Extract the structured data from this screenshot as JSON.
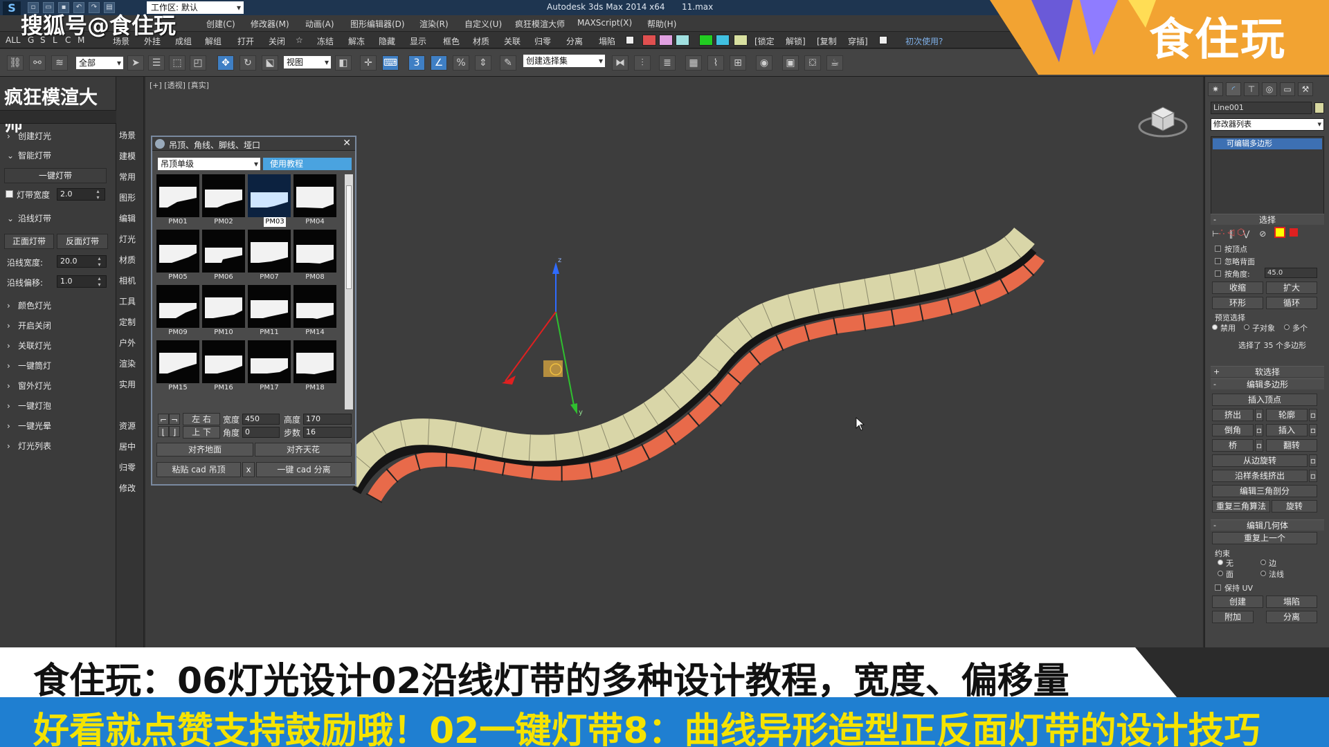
{
  "title_bar": {
    "workspace": "工作区: 默认",
    "app_title": "Autodesk 3ds Max  2014 x64",
    "file_title": "11.max"
  },
  "menu": [
    "创建(C)",
    "修改器(M)",
    "动画(A)",
    "图形编辑器(D)",
    "渲染(R)",
    "自定义(U)",
    "疯狂模渲大师",
    "MAXScript(X)",
    "帮助(H)"
  ],
  "text_toolbar": {
    "left_items": [
      "ALL",
      "G",
      "S",
      "L",
      "C",
      "M",
      "场景",
      "外挂",
      "成组",
      "解组",
      "打开",
      "关闭",
      "☆",
      "冻结",
      "解冻",
      "隐藏",
      "显示",
      "框色",
      "材质",
      "关联",
      "归零",
      "分离",
      "塌陷"
    ],
    "right_items": [
      "[锁定",
      "解锁]",
      "[复制",
      "穿插]"
    ],
    "first_use": "初次使用?",
    "swatch_colors": [
      "#e05050",
      "#e0a0e0",
      "#a0e0e0",
      "#22cc22",
      "#40c0e0",
      "#d8e0a0"
    ]
  },
  "icon_toolbar": {
    "filter": "全部",
    "view": "视图",
    "selection_set": "创建选择集"
  },
  "left_panel": {
    "title": "疯狂模渲大师",
    "rows": [
      {
        "label": "创建灯光",
        "open": false
      },
      {
        "label": "智能灯带",
        "open": true
      }
    ],
    "one_click_strip": "一键灯带",
    "strip_width_label": "灯带宽度",
    "strip_width_value": "2.0",
    "edge_strip_label": "沿线灯带",
    "front_strip": "正面灯带",
    "back_strip": "反面灯带",
    "edge_width_label": "沿线宽度:",
    "edge_width_value": "20.0",
    "edge_offset_label": "沿线偏移:",
    "edge_offset_value": "1.0",
    "more_rows": [
      "颜色灯光",
      "开启关闭",
      "关联灯光",
      "一键筒灯",
      "窗外灯光",
      "一键灯泡",
      "一键光晕",
      "灯光列表"
    ]
  },
  "categories": [
    "场景",
    "建模",
    "常用",
    "图形",
    "编辑",
    "灯光",
    "材质",
    "相机",
    "工具",
    "定制",
    "户外",
    "渲染",
    "实用",
    "资源",
    "居中",
    "归零",
    "修改"
  ],
  "viewport": {
    "label": "[+] [透视] [真实]"
  },
  "dialog": {
    "title": "吊顶、角线、脚线、垭口",
    "select_value": "吊顶单级",
    "tutorial": "使用教程",
    "tiles": [
      "PM01",
      "PM02",
      "PM03",
      "PM04",
      "PM05",
      "PM06",
      "PM07",
      "PM08",
      "PM09",
      "PM10",
      "PM11",
      "PM14",
      "PM15",
      "PM16",
      "PM17",
      "PM18"
    ],
    "selected_tile": "PM03",
    "left_right": "左 右",
    "up_down": "上 下",
    "width_label": "宽度",
    "width_value": "450",
    "height_label": "高度",
    "height_value": "170",
    "angle_label": "角度",
    "angle_value": "0",
    "steps_label": "步数",
    "steps_value": "16",
    "align_floor": "对齐地面",
    "align_ceiling": "对齐天花",
    "paste_cad": "粘贴 cad 吊顶",
    "x": "x",
    "separate_cad": "一键 cad 分离"
  },
  "right_panel": {
    "object_name": "Line001",
    "modifier_list": "修改器列表",
    "stack_item": "可编辑多边形",
    "selection_head": "选择",
    "by_vertex": "按顶点",
    "ignore_back": "忽略背面",
    "by_angle": "按角度:",
    "angle_value": "45.0",
    "shrink": "收缩",
    "grow": "扩大",
    "ring": "环形",
    "loop": "循环",
    "preview_select": "预览选择",
    "disable": "禁用",
    "sub_object": "子对象",
    "multi": "多个",
    "selected_info": "选择了 35 个多边形",
    "soft_select": "软选择",
    "edit_poly": "编辑多边形",
    "insert_vertex": "插入顶点",
    "extrude": "挤出",
    "outline": "轮廓",
    "bevel": "倒角",
    "inset": "插入",
    "bridge": "桥",
    "flip": "翻转",
    "hinge": "从边旋转",
    "extrude_spline": "沿样条线挤出",
    "edit_tri": "编辑三角剖分",
    "retriangulate": "重复三角算法",
    "turn": "旋转",
    "edit_geometry": "编辑几何体",
    "repeat_last": "重复上一个",
    "constraints": "约束",
    "none": "无",
    "edge": "边",
    "face": "面",
    "normal": "法线",
    "preserve_uv": "保持 UV",
    "create": "创建",
    "collapse": "塌陷",
    "attach": "附加",
    "separate": "分离"
  },
  "overlay": {
    "watermark": "搜狐号@食住玩",
    "brand": "食住玩",
    "caption1": "食住玩：06灯光设计02沿线灯带的多种设计教程，宽度、偏移量",
    "caption2": "好看就点赞支持鼓励哦！02一键灯带8：曲线异形造型正反面灯带的设计技巧"
  }
}
